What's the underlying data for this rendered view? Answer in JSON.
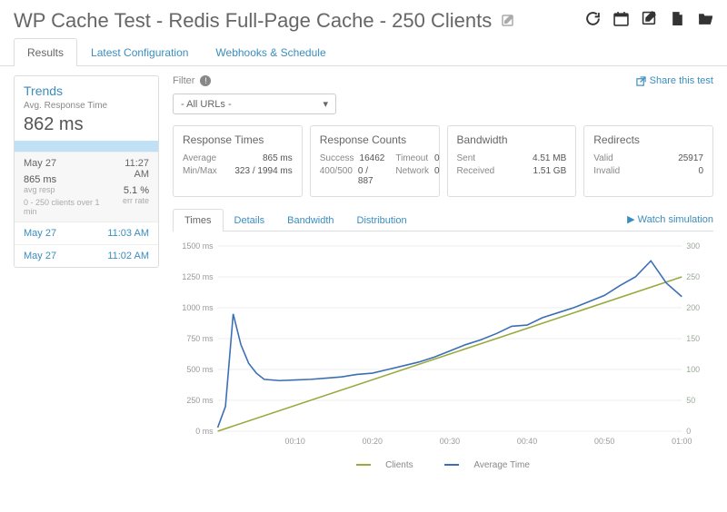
{
  "header": {
    "title": "WP Cache Test - Redis Full-Page Cache - 250 Clients"
  },
  "top_tabs": {
    "results": "Results",
    "config": "Latest Configuration",
    "webhooks": "Webhooks & Schedule"
  },
  "trends": {
    "title": "Trends",
    "sub": "Avg. Response Time",
    "big": "862 ms",
    "head_date": "May 27",
    "head_time": "11:27 AM",
    "avg_val": "865 ms",
    "avg_lbl": "avg resp",
    "err_val": "5.1 %",
    "err_lbl": "err rate",
    "clients_line": "0  -  250 clients over 1 min",
    "rows": [
      {
        "date": "May 27",
        "time": "11:03 AM"
      },
      {
        "date": "May 27",
        "time": "11:02 AM"
      }
    ]
  },
  "filter": {
    "label": "Filter",
    "select": "- All URLs -",
    "share": "Share this test"
  },
  "cards": {
    "rt": {
      "title": "Response Times",
      "avg_l": "Average",
      "avg_v": "865 ms",
      "mm_l": "Min/Max",
      "mm_v": "323 / 1994 ms"
    },
    "rc": {
      "title": "Response Counts",
      "s_l": "Success",
      "s_v": "16462",
      "e_l": "400/500",
      "e_v": "0 / 887",
      "t_l": "Timeout",
      "t_v": "0",
      "n_l": "Network",
      "n_v": "0"
    },
    "bw": {
      "title": "Bandwidth",
      "sent_l": "Sent",
      "sent_v": "4.51 MB",
      "recv_l": "Received",
      "recv_v": "1.51 GB"
    },
    "rd": {
      "title": "Redirects",
      "v_l": "Valid",
      "v_v": "25917",
      "i_l": "Invalid",
      "i_v": "0"
    }
  },
  "chart_tabs": {
    "times": "Times",
    "details": "Details",
    "bandwidth": "Bandwidth",
    "distribution": "Distribution",
    "watch": "Watch simulation"
  },
  "legend": {
    "clients": "Clients",
    "avg": "Average Time"
  },
  "chart_data": {
    "type": "line",
    "xlabel": "",
    "y_left_label": "ms",
    "y_right_label": "clients",
    "y_left_ticks": [
      "0 ms",
      "250 ms",
      "500 ms",
      "750 ms",
      "1000 ms",
      "1250 ms",
      "1500 ms"
    ],
    "y_left_range": [
      0,
      1500
    ],
    "y_right_ticks": [
      "0",
      "50",
      "100",
      "150",
      "200",
      "250",
      "300"
    ],
    "y_right_range": [
      0,
      300
    ],
    "x_ticks": [
      "00:10",
      "00:20",
      "00:30",
      "00:40",
      "00:50",
      "01:00"
    ],
    "x_range_seconds": [
      0,
      60
    ],
    "series": [
      {
        "name": "Clients",
        "axis": "right",
        "color": "#98a93f",
        "x_seconds": [
          0,
          60
        ],
        "values": [
          0,
          250
        ]
      },
      {
        "name": "Average Time",
        "axis": "left",
        "color": "#3b6fb5",
        "x_seconds": [
          0,
          1,
          2,
          3,
          4,
          5,
          6,
          8,
          10,
          12,
          14,
          16,
          18,
          20,
          22,
          24,
          26,
          28,
          30,
          32,
          34,
          36,
          38,
          40,
          42,
          44,
          46,
          48,
          50,
          52,
          54,
          56,
          58,
          60
        ],
        "values": [
          30,
          200,
          950,
          700,
          550,
          470,
          420,
          410,
          415,
          420,
          430,
          440,
          460,
          470,
          500,
          530,
          560,
          600,
          650,
          700,
          740,
          790,
          850,
          860,
          920,
          960,
          1000,
          1050,
          1100,
          1180,
          1250,
          1380,
          1200,
          1090
        ]
      }
    ]
  }
}
